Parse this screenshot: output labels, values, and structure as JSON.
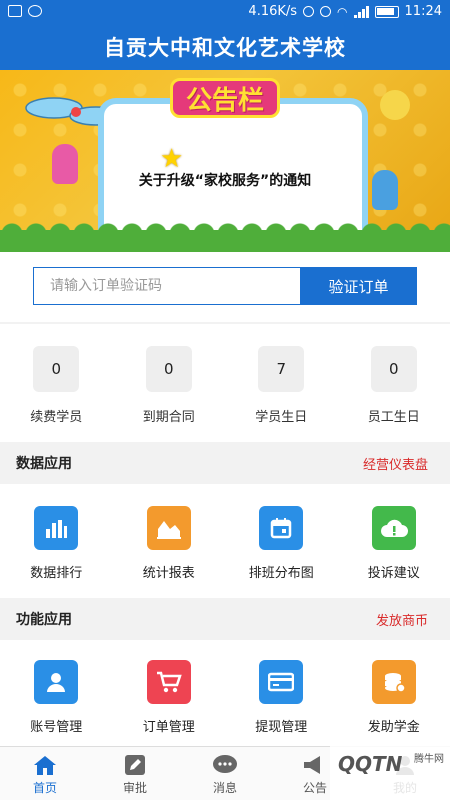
{
  "status_bar": {
    "speed": "4.16K/s",
    "time": "11:24"
  },
  "title": "自贡大中和文化艺术学校",
  "banner": {
    "board_title": "公告栏",
    "notice": "关于升级“家校服务”的通知"
  },
  "verify": {
    "placeholder": "请输入订单验证码",
    "button": "验证订单"
  },
  "stats": [
    {
      "value": "0",
      "label": "续费学员"
    },
    {
      "value": "0",
      "label": "到期合同"
    },
    {
      "value": "7",
      "label": "学员生日"
    },
    {
      "value": "0",
      "label": "员工生日"
    }
  ],
  "data_section": {
    "title": "数据应用",
    "link": "经营仪表盘",
    "items": [
      {
        "label": "数据排行",
        "icon": "bar-chart-icon",
        "color": "#2a8fe6"
      },
      {
        "label": "统计报表",
        "icon": "area-chart-icon",
        "color": "#f39a2d"
      },
      {
        "label": "排班分布图",
        "icon": "calendar-icon",
        "color": "#2a8fe6"
      },
      {
        "label": "投诉建议",
        "icon": "cloud-alert-icon",
        "color": "#43b94b"
      }
    ]
  },
  "func_section": {
    "title": "功能应用",
    "link": "发放商币",
    "items": [
      {
        "label": "账号管理",
        "icon": "user-icon",
        "color": "#2a8fe6"
      },
      {
        "label": "订单管理",
        "icon": "cart-icon",
        "color": "#ee4452"
      },
      {
        "label": "提现管理",
        "icon": "card-icon",
        "color": "#2a8fe6"
      },
      {
        "label": "发助学金",
        "icon": "coins-icon",
        "color": "#f39a2d"
      }
    ]
  },
  "tabs": [
    {
      "label": "首页",
      "icon": "home-icon",
      "active": true
    },
    {
      "label": "审批",
      "icon": "edit-icon",
      "active": false
    },
    {
      "label": "消息",
      "icon": "message-icon",
      "active": false
    },
    {
      "label": "公告",
      "icon": "megaphone-icon",
      "active": false
    },
    {
      "label": "我的",
      "icon": "user-icon",
      "active": false
    }
  ],
  "watermark": {
    "text": "QQTN",
    "sub": "腾牛网"
  },
  "colors": {
    "primary": "#1a6fd0",
    "accent_red": "#d92b2b"
  }
}
